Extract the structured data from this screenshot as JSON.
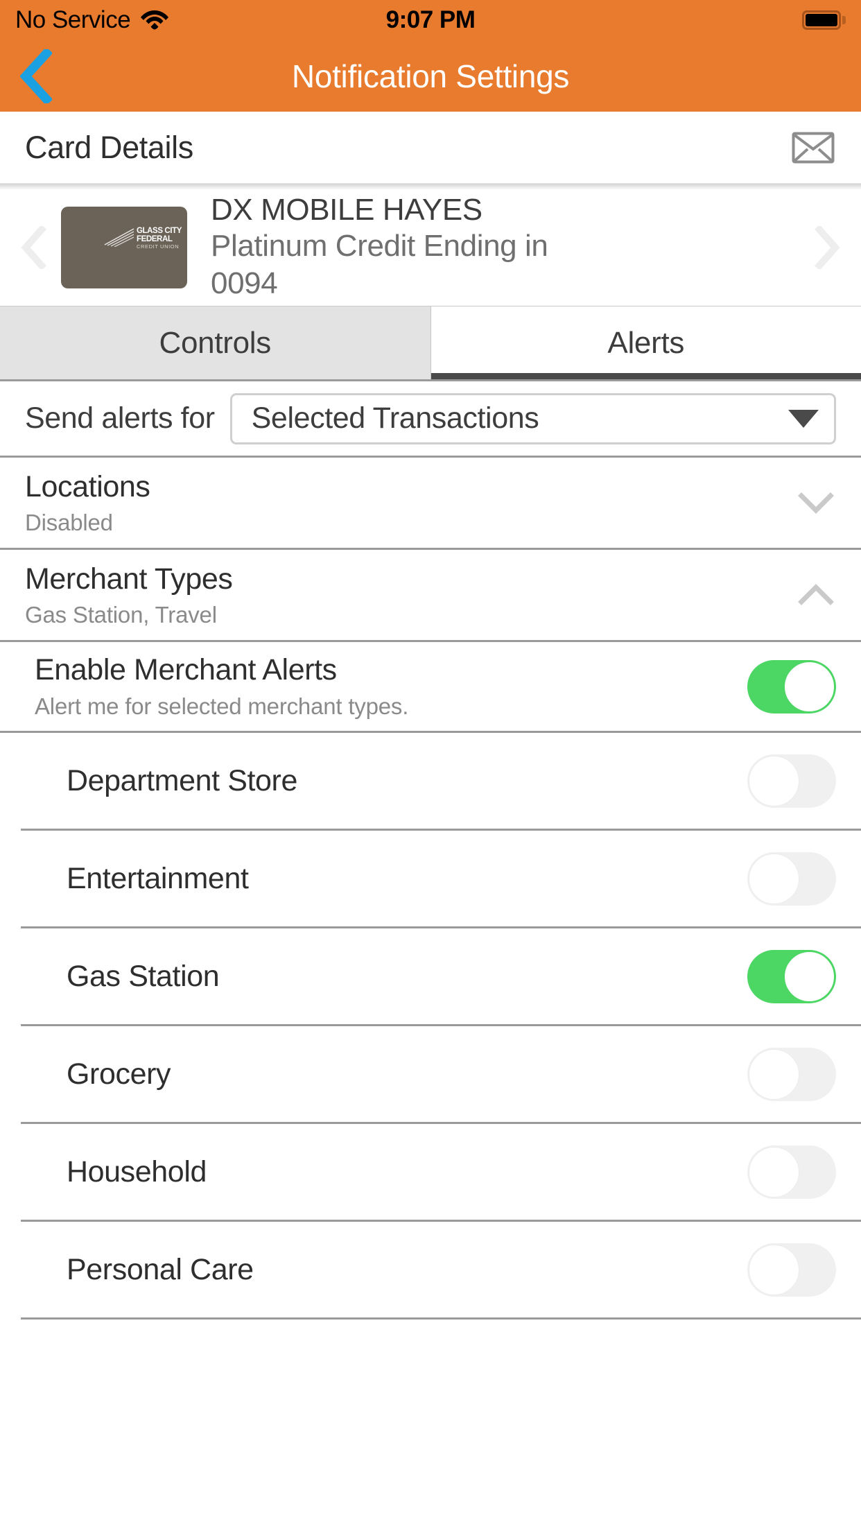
{
  "status_bar": {
    "carrier": "No Service",
    "wifi_icon": "wifi-icon",
    "time": "9:07 PM",
    "battery_icon": "battery-full-icon"
  },
  "nav_bar": {
    "back_icon": "chevron-left-icon",
    "title": "Notification Settings",
    "back_color": "#1ba1e2"
  },
  "card_details": {
    "title": "Card Details",
    "envelope_icon": "envelope-icon"
  },
  "carousel": {
    "prev_icon": "chevron-left-icon",
    "next_icon": "chevron-right-icon",
    "card": {
      "logo_line1": "GLASS CITY",
      "logo_line2": "FEDERAL",
      "logo_line3": "CREDIT UNION",
      "art_color": "#6b6358"
    },
    "name": "DX MOBILE HAYES",
    "description": "Platinum Credit Ending in 0094"
  },
  "tabs": [
    {
      "label": "Controls",
      "active": false
    },
    {
      "label": "Alerts",
      "active": true
    }
  ],
  "send_alerts": {
    "label": "Send alerts for",
    "selected": "Selected Transactions",
    "caret_icon": "chevron-down-icon"
  },
  "sections": [
    {
      "title": "Locations",
      "subtitle": "Disabled",
      "expanded": false,
      "chevron_icon": "chevron-down-icon"
    },
    {
      "title": "Merchant Types",
      "subtitle": "Gas Station, Travel",
      "expanded": true,
      "chevron_icon": "chevron-up-icon"
    }
  ],
  "enable_merchant_alerts": {
    "title": "Enable Merchant Alerts",
    "subtitle": "Alert me for selected merchant types.",
    "toggle_on": true
  },
  "merchant_types": [
    {
      "label": "Department Store",
      "toggle_on": false
    },
    {
      "label": "Entertainment",
      "toggle_on": false
    },
    {
      "label": "Gas Station",
      "toggle_on": true
    },
    {
      "label": "Grocery",
      "toggle_on": false
    },
    {
      "label": "Household",
      "toggle_on": false
    },
    {
      "label": "Personal Care",
      "toggle_on": false
    }
  ],
  "colors": {
    "header_orange": "#e87b2e",
    "toggle_on_green": "#4cd664",
    "back_blue": "#1ba1e2",
    "divider_gray": "#9a9a9a"
  }
}
